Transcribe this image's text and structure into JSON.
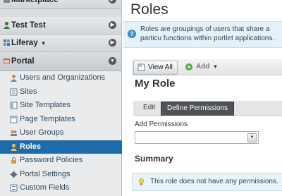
{
  "sidebar": {
    "sections": [
      {
        "label": "Marketplace",
        "icon": "marketplace-icon"
      },
      {
        "label": "Test Test",
        "icon": "user-icon"
      },
      {
        "label": "Liferay",
        "icon": "liferay-icon",
        "dropdown": "▼"
      }
    ],
    "portal": {
      "label": "Portal",
      "icon": "portal-icon",
      "items": [
        {
          "label": "Users and Organizations",
          "icon": "users-icon"
        },
        {
          "label": "Sites",
          "icon": "sites-icon"
        },
        {
          "label": "Site Templates",
          "icon": "site-templates-icon"
        },
        {
          "label": "Page Templates",
          "icon": "page-templates-icon"
        },
        {
          "label": "User Groups",
          "icon": "user-groups-icon"
        },
        {
          "label": "Roles",
          "icon": "roles-icon",
          "active": true
        },
        {
          "label": "Password Policies",
          "icon": "password-policies-icon"
        },
        {
          "label": "Portal Settings",
          "icon": "gear-icon"
        },
        {
          "label": "Custom Fields",
          "icon": "custom-fields-icon"
        }
      ]
    }
  },
  "main": {
    "title": "Roles",
    "info": "Roles are groupings of users that share a particu functions within portlet applications.",
    "info_line1": "Roles are groupings of users that share a particu",
    "info_line2": "functions within portlet applications.",
    "toolbar": {
      "view_all": "View All",
      "add": "Add"
    },
    "role_name": "My Role",
    "tabs": [
      {
        "label": "Edit"
      },
      {
        "label": "Define Permissions",
        "active": true
      }
    ],
    "add_permissions_label": "Add Permissions",
    "add_permissions_value": "",
    "summary_title": "Summary",
    "no_permissions": "This role does not have any permissions."
  },
  "colors": {
    "active_item": "#1f6aa8",
    "sidebar_bg": "#d9dde0",
    "info_bg": "#e4f1f8"
  }
}
